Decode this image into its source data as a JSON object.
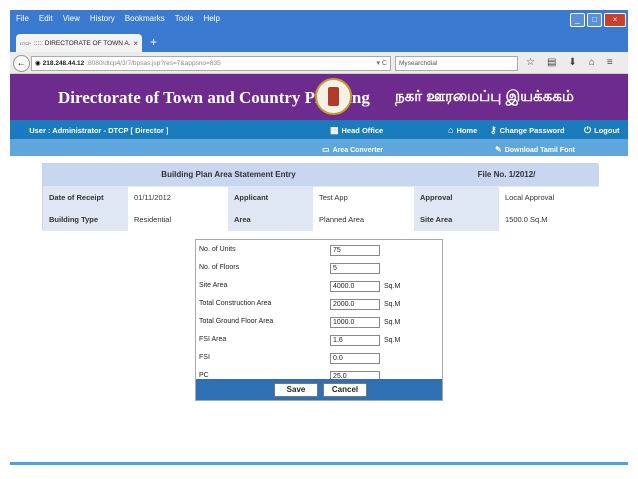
{
  "browser": {
    "menu": [
      "File",
      "Edit",
      "View",
      "History",
      "Bookmarks",
      "Tools",
      "Help"
    ],
    "tab_title": "::::: DIRECTORATE OF TOWN A...",
    "tab_favicon": "DTCP",
    "tab_close": "×",
    "new_tab": "+",
    "url_host": "218.248.44.12",
    "url_path": ":8080/dtcp4/3/7/bpsas.jsp?res=7&appsno=835",
    "url_controls": "▾ C",
    "search_placeholder": "Mysearchdial",
    "window_buttons": [
      "_",
      "□",
      "×"
    ]
  },
  "header": {
    "title_en": "Directorate of Town and Country Planning",
    "title_ta": "நகர் ஊரமைப்பு இயக்ககம்"
  },
  "userbar": {
    "user": "User : Administrator - DTCP   [ Director ]",
    "head_office": "Head Office",
    "home": "Home",
    "change_password": "Change Password",
    "logout": "Logout"
  },
  "subbar": {
    "area_converter": "Area Converter",
    "download_font": "Download Tamil Font"
  },
  "info": {
    "heading": "Building Plan Area Statement Entry",
    "file_no": "File No. 1/2012/",
    "rows": [
      [
        {
          "label": "Date of Receipt",
          "value": "01/11/2012"
        },
        {
          "label": "Applicant",
          "value": "Test App"
        },
        {
          "label": "Approval",
          "value": "Local Approval"
        }
      ],
      [
        {
          "label": "Building Type",
          "value": "Residential"
        },
        {
          "label": "Area",
          "value": "Planned Area"
        },
        {
          "label": "Site Area",
          "value": "1500.0 Sq.M"
        }
      ]
    ]
  },
  "form": {
    "fields": [
      {
        "label": "No. of Units",
        "value": "75",
        "unit": ""
      },
      {
        "label": "No. of Floors",
        "value": "5",
        "unit": ""
      },
      {
        "label": "Site Area",
        "value": "4000.0",
        "unit": "Sq.M"
      },
      {
        "label": "Total Construction Area",
        "value": "2000.0",
        "unit": "Sq.M"
      },
      {
        "label": "Total Ground Floor Area",
        "value": "1000.0",
        "unit": "Sq.M"
      },
      {
        "label": "FSI Area",
        "value": "1.6",
        "unit": "Sq.M"
      },
      {
        "label": "FSI",
        "value": "0.0",
        "unit": ""
      },
      {
        "label": "PC",
        "value": "25.0",
        "unit": ""
      }
    ],
    "save_label": "Save",
    "cancel_label": "Cancel"
  },
  "colors": {
    "banner": "#6e2b8e",
    "userbar": "#1a7bbd",
    "subbar": "#5ea6dc",
    "button_bar": "#2f6fb3"
  }
}
